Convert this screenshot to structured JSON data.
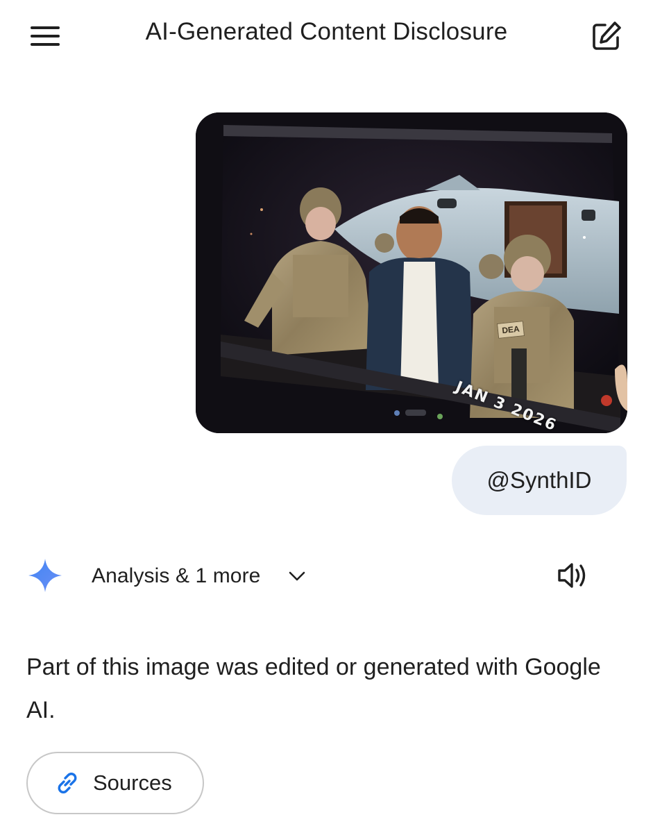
{
  "header": {
    "title": "AI-Generated Content Disclosure",
    "menu_icon": "hamburger-menu-icon",
    "edit_icon": "edit-icon"
  },
  "conversation": {
    "uploaded_image": {
      "overlay_text": "JAN 3 2026",
      "patch_text": "DEA"
    },
    "user_message": "@SynthID",
    "response": {
      "tools_label": "Analysis & 1 more",
      "text": "Part of this image was edited or generated with Google AI.",
      "sources_label": "Sources",
      "icons": {
        "assistant": "gemini-sparkle-icon",
        "expand": "chevron-down-icon",
        "read_aloud": "speaker-icon",
        "sources": "link-icon"
      }
    }
  },
  "colors": {
    "user_bubble_bg": "#e9eef6",
    "sparkle_blue": "#4285f4",
    "link_blue": "#1a73e8",
    "text": "#1f1f1f",
    "chip_border": "#c7c7c7"
  }
}
